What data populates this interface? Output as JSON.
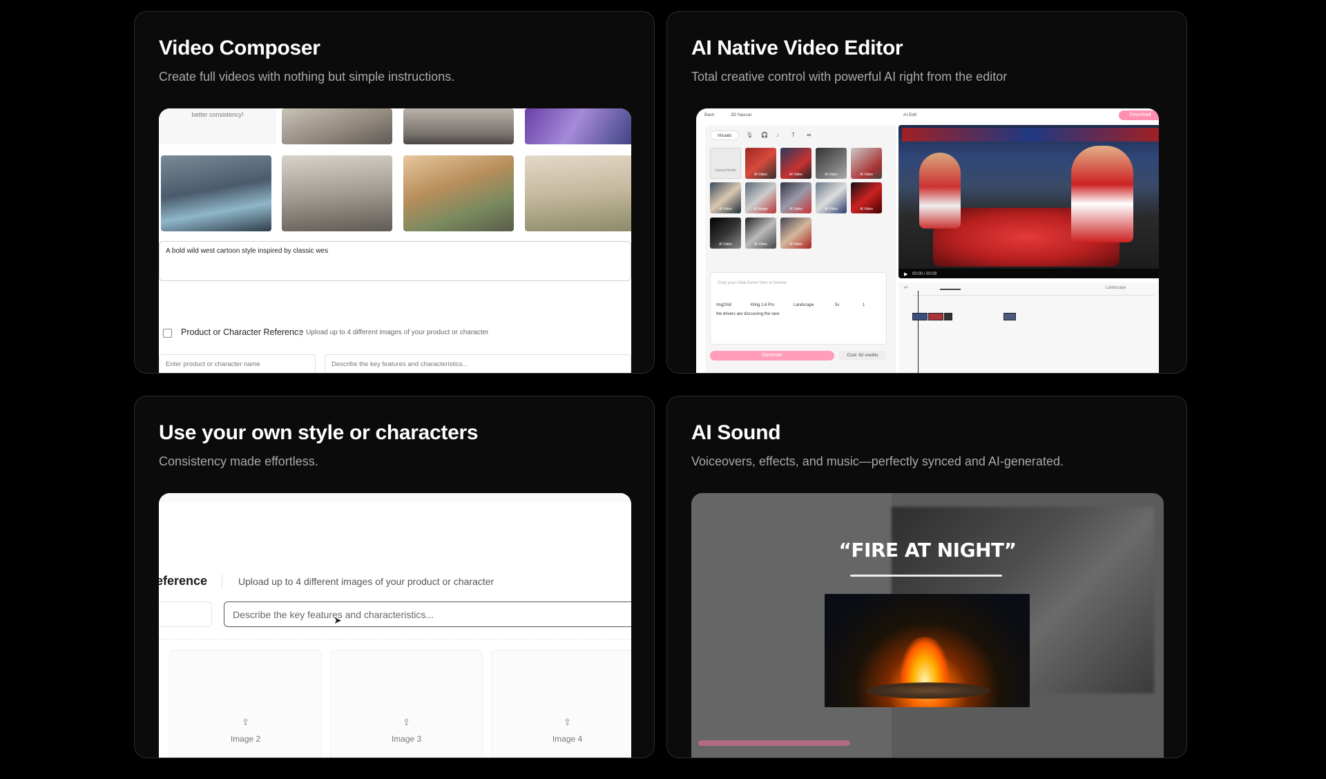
{
  "cards": [
    {
      "title": "Video Composer",
      "subtitle": "Create full videos with nothing but simple instructions.",
      "screen": {
        "hint": "better consistency!",
        "prompt_value": "A bold wild west cartoon style inspired by classic wes",
        "reference_title": "Product or Character Reference",
        "reference_desc": "Upload up to 4 different images of your product or character",
        "name_placeholder": "Enter product or character name",
        "features_placeholder": "Describe the key features and characteristics..."
      }
    },
    {
      "title": "AI Native Video Editor",
      "subtitle": "Total creative control with powerful AI right from the editor",
      "screen": {
        "back": "Back",
        "project": "3D Nascar",
        "ai_edit": "AI Edit",
        "download": "Download",
        "visuals_tab": "Visuals",
        "upload_media": "Upload Media",
        "tile_label_video": "AI Video",
        "tile_label_image": "AI Image",
        "prompt_placeholder": "Drop your initial frame here or browse",
        "model": "Kling 1.6 Pro",
        "mode": "Img2Vid",
        "aspect": "Landscape",
        "duration": "5s",
        "count": "1",
        "prompt_text": "the drivers are discussing the race",
        "generate": "Generate",
        "cost": "Cost: 62 credits",
        "time": "00:00 / 00:09",
        "timeline_aspect": "Landscape"
      }
    },
    {
      "title": "Use your own style or characters",
      "subtitle": "Consistency made effortless.",
      "screen": {
        "reference_title": "eference",
        "reference_desc": "Upload up to 4 different images of your product or character",
        "features_placeholder": "Describe the key features and characteristics...",
        "images": [
          "Image 2",
          "Image 3",
          "Image 4"
        ]
      }
    },
    {
      "title": "AI Sound",
      "subtitle": "Voiceovers, effects, and music—perfectly synced and AI-generated.",
      "screen": {
        "quote": "“FIRE AT NIGHT”"
      }
    }
  ]
}
